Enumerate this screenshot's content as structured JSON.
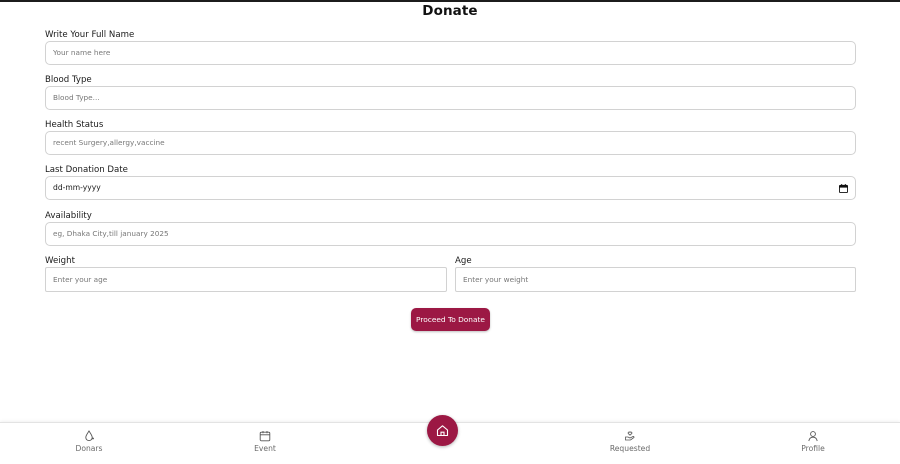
{
  "page_title": "Donate",
  "form": {
    "full_name": {
      "label": "Write Your Full Name",
      "placeholder": "Your name here"
    },
    "blood_type": {
      "label": "Blood Type",
      "placeholder": "Blood Type..."
    },
    "health_status": {
      "label": "Health Status",
      "placeholder": "recent Surgery,allergy,vaccine"
    },
    "last_donation_date": {
      "label": "Last Donation Date",
      "value": "dd-mm-yyyy"
    },
    "availability": {
      "label": "Availability",
      "placeholder": "eg, Dhaka City,till january 2025"
    },
    "weight": {
      "label": "Weight",
      "placeholder": "Enter your age"
    },
    "age": {
      "label": "Age",
      "placeholder": "Enter your weight"
    },
    "submit_label": "Proceed To Donate"
  },
  "bottom_nav": {
    "items": [
      {
        "label": "Donars",
        "icon": "blood-drop-icon"
      },
      {
        "label": "Event",
        "icon": "calendar-icon"
      },
      {
        "label": "Home",
        "icon": "home-icon"
      },
      {
        "label": "Requested",
        "icon": "hand-heart-icon"
      },
      {
        "label": "Profile",
        "icon": "user-icon"
      }
    ]
  },
  "colors": {
    "accent": "#9c1844",
    "border": "#d2d2d2",
    "placeholder": "#777777"
  }
}
